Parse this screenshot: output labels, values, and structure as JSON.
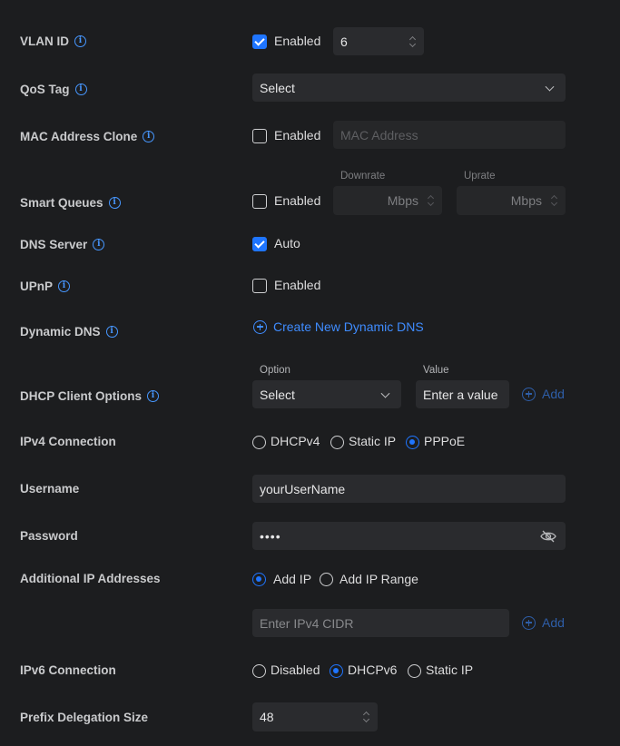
{
  "vlan_id": {
    "label": "VLAN ID",
    "enabled_label": "Enabled",
    "enabled": true,
    "value": "6"
  },
  "qos_tag": {
    "label": "QoS Tag",
    "select_value": "Select"
  },
  "mac_clone": {
    "label": "MAC Address Clone",
    "enabled_label": "Enabled",
    "enabled": false,
    "placeholder": "MAC Address"
  },
  "smart_queues": {
    "label": "Smart Queues",
    "enabled_label": "Enabled",
    "enabled": false,
    "downrate_label": "Downrate",
    "uprate_label": "Uprate",
    "downrate_unit": "Mbps",
    "uprate_unit": "Mbps"
  },
  "dns_server": {
    "label": "DNS Server",
    "auto_label": "Auto",
    "auto": true
  },
  "upnp": {
    "label": "UPnP",
    "enabled_label": "Enabled",
    "enabled": false
  },
  "dynamic_dns": {
    "label": "Dynamic DNS",
    "create_link": "Create New Dynamic DNS"
  },
  "dhcp_client_options": {
    "label": "DHCP Client Options",
    "option_label": "Option",
    "value_label": "Value",
    "option_select": "Select",
    "value_placeholder": "Enter a value",
    "add_label": "Add"
  },
  "ipv4_connection": {
    "label": "IPv4 Connection",
    "options": [
      "DHCPv4",
      "Static IP",
      "PPPoE"
    ],
    "selected": "PPPoE"
  },
  "username": {
    "label": "Username",
    "value": "yourUserName"
  },
  "password": {
    "label": "Password",
    "value": "••••"
  },
  "additional_ip": {
    "label": "Additional IP Addresses",
    "options": [
      "Add IP",
      "Add IP Range"
    ],
    "selected": "Add IP",
    "placeholder": "Enter IPv4 CIDR",
    "add_label": "Add"
  },
  "ipv6_connection": {
    "label": "IPv6 Connection",
    "options": [
      "Disabled",
      "DHCPv6",
      "Static IP"
    ],
    "selected": "DHCPv6"
  },
  "prefix_delegation": {
    "label": "Prefix Delegation Size",
    "value": "48"
  },
  "colors": {
    "accent": "#1f75ff",
    "link": "#3f8cff",
    "background": "#1c1d1f",
    "field": "#2a2b2e"
  }
}
